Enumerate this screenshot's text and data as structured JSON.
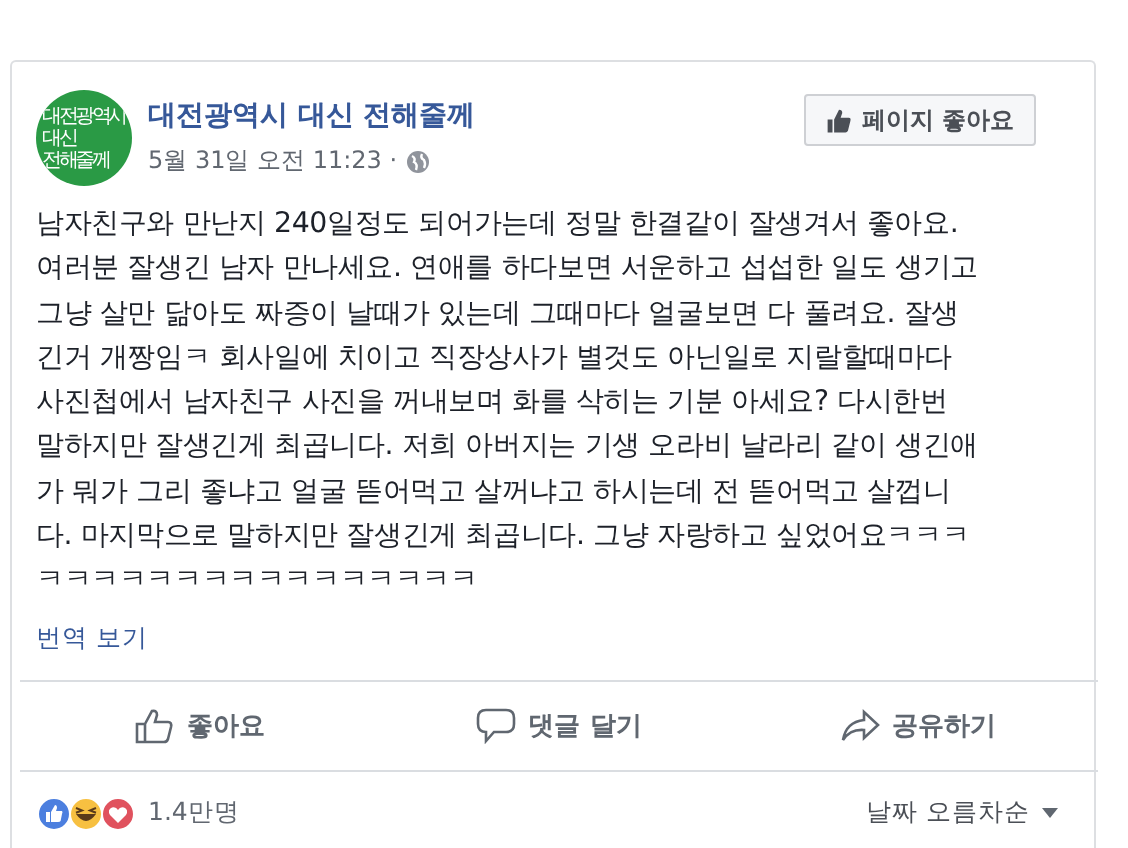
{
  "page": {
    "name": "대전광역시 대신 전해줄께",
    "avatar_lines": [
      "대전광역시",
      "대신",
      "전해줄께"
    ],
    "timestamp": "5월 31일 오전 11:23 ·",
    "like_page_button": "페이지 좋아요"
  },
  "post": {
    "lines": [
      "남자친구와 만난지 240일정도 되어가는데 정말 한결같이 잘생겨서 좋아요.",
      "여러분 잘생긴 남자 만나세요. 연애를 하다보면 서운하고 섭섭한 일도 생기고",
      "그냥 살만 닮아도 짜증이 날때가 있는데 그때마다 얼굴보면 다 풀려요. 잘생",
      "긴거 개짱임ㅋ 회사일에 치이고 직장상사가 별것도 아닌일로 지랄할때마다",
      "사진첩에서 남자친구 사진을 꺼내보며 화를 삭히는 기분 아세요? 다시한번",
      "말하지만 잘생긴게 최곱니다. 저희 아버지는 기생 오라비 날라리 같이 생긴애",
      "가 뭐가 그리 좋냐고 얼굴 뜯어먹고 살꺼냐고 하시는데 전 뜯어먹고 살껍니",
      "다. 마지막으로 말하지만 잘생긴게 최곱니다. 그냥 자랑하고 싶었어요ㅋㅋㅋ",
      "ㅋㅋㅋㅋㅋㅋㅋㅋㅋㅋㅋㅋㅋㅋㅋㅋ"
    ],
    "translate_link": "번역 보기"
  },
  "actions": [
    {
      "kind": "like",
      "label": "좋아요"
    },
    {
      "kind": "comment",
      "label": "댓글 달기"
    },
    {
      "kind": "share",
      "label": "공유하기"
    }
  ],
  "reactions": {
    "count": "1.4만명",
    "sort": "날짜 오름차순"
  }
}
